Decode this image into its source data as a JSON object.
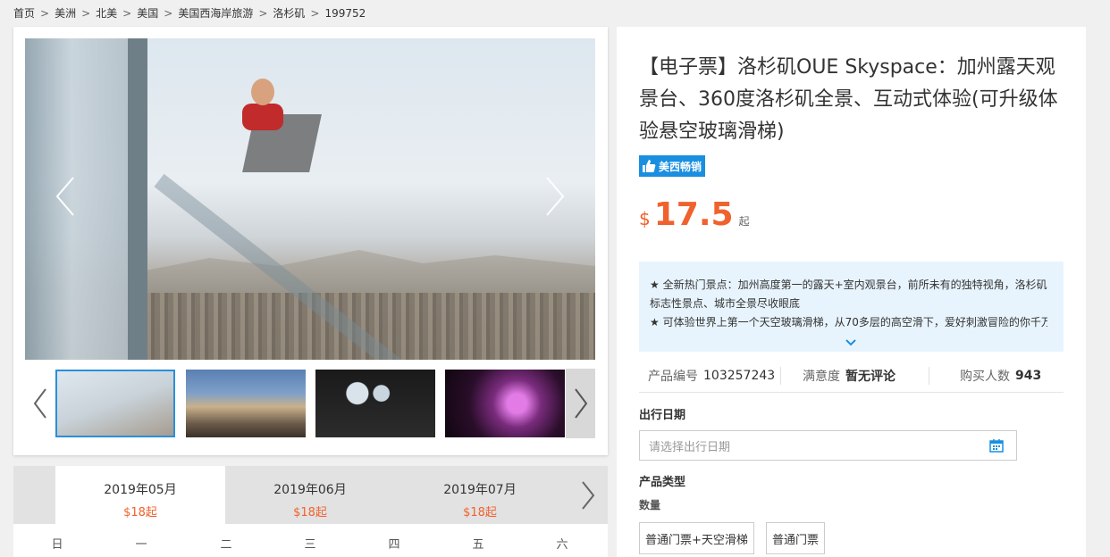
{
  "breadcrumb": {
    "items": [
      "首页",
      "美洲",
      "北美",
      "美国",
      "美国西海岸旅游",
      "洛杉矶",
      "199752"
    ],
    "separator": ">"
  },
  "gallery": {
    "thumbnail_count": 4
  },
  "calendar": {
    "months": [
      {
        "label": "2019年05月",
        "price": "$18起"
      },
      {
        "label": "2019年06月",
        "price": "$18起"
      },
      {
        "label": "2019年07月",
        "price": "$18起"
      }
    ],
    "weekdays": [
      "日",
      "一",
      "二",
      "三",
      "四",
      "五",
      "六"
    ]
  },
  "product": {
    "title": "【电子票】洛杉矶OUE Skyspace：加州露天观景台、360度洛杉矶全景、互动式体验(可升级体验悬空玻璃滑梯)",
    "badge": "美西畅销",
    "currency": "$",
    "price": "17.5",
    "price_suffix": "起",
    "highlights": [
      "★ 全新热门景点：加州高度第一的露天+室内观景台，前所未有的独特视角，洛杉矶标志性景点、城市全景尽收眼底",
      "★ 可体验世界上第一个天空玻璃滑梯，从70多层的高空滑下，爱好刺激冒险的你千万"
    ],
    "meta": {
      "code_label": "产品编号",
      "code_value": "103257243",
      "rating_label": "满意度",
      "rating_value": "暂无评论",
      "buyers_label": "购买人数",
      "buyers_value": "943"
    },
    "date_label": "出行日期",
    "date_placeholder": "请选择出行日期",
    "type_label": "产品类型",
    "quantity_label": "数量",
    "options": [
      "普通门票+天空滑梯",
      "普通门票"
    ]
  },
  "colors": {
    "accent_orange": "#f0622d",
    "badge_blue": "#1a8fe0",
    "highlight_bg": "#e8f4fd"
  }
}
